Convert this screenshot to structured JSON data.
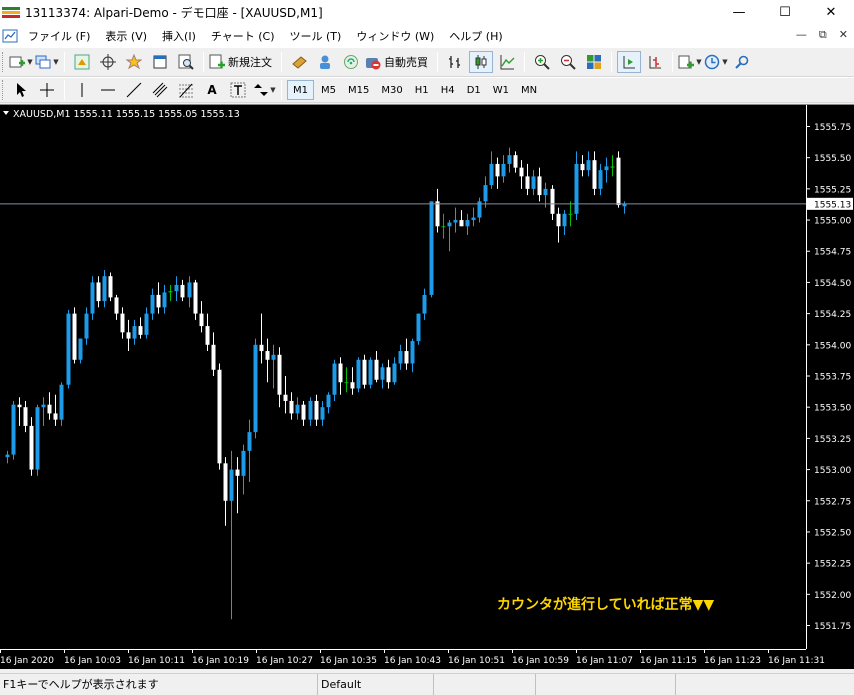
{
  "window": {
    "title": "13113374: Alpari-Demo - デモ口座 - [XAUUSD,M1]",
    "minimize": "—",
    "maximize": "☐",
    "close": "✕"
  },
  "menu": {
    "items": [
      "ファイル (F)",
      "表示 (V)",
      "挿入(I)",
      "チャート (C)",
      "ツール (T)",
      "ウィンドウ (W)",
      "ヘルプ (H)"
    ],
    "mdi": [
      "—",
      "⧉",
      "✕"
    ]
  },
  "toolbar": {
    "new_order_label": "新規注文",
    "auto_trade_label": "自動売買"
  },
  "timeframes": [
    "M1",
    "M5",
    "M15",
    "M30",
    "H1",
    "H4",
    "D1",
    "W1",
    "MN"
  ],
  "timeframe_selected": "M1",
  "chart_data": {
    "type": "candlestick",
    "symbol_info": "XAUUSD,M1  1555.11 1555.15 1555.05 1555.13",
    "current_price": "1555.13",
    "ylim": [
      1551.65,
      1555.85
    ],
    "y_ticks": [
      "1555.75",
      "1555.50",
      "1555.25",
      "1555.00",
      "1554.75",
      "1554.50",
      "1554.25",
      "1554.00",
      "1553.75",
      "1553.50",
      "1553.25",
      "1553.00",
      "1552.75",
      "1552.50",
      "1552.25",
      "1552.00",
      "1551.75"
    ],
    "x_ticks": [
      "16 Jan 2020",
      "16 Jan 10:03",
      "16 Jan 10:11",
      "16 Jan 10:19",
      "16 Jan 10:27",
      "16 Jan 10:35",
      "16 Jan 10:43",
      "16 Jan 10:51",
      "16 Jan 10:59",
      "16 Jan 11:07",
      "16 Jan 11:15",
      "16 Jan 11:23",
      "16 Jan 11:31"
    ],
    "annotation": "カウンタが進行していれば正常▼▼",
    "colors": {
      "bull": "#1e9be8",
      "bear": "#ffffff",
      "doji": "#00c000",
      "background": "#000000",
      "grid": "#000000",
      "axis_text": "#ffffff",
      "price_line": "#7f8f9f",
      "annotation": "#ffd700"
    },
    "candles": [
      {
        "o": 1553.1,
        "h": 1553.15,
        "l": 1553.05,
        "c": 1553.12
      },
      {
        "o": 1553.12,
        "h": 1553.55,
        "l": 1553.08,
        "c": 1553.52
      },
      {
        "o": 1553.52,
        "h": 1553.58,
        "l": 1553.35,
        "c": 1553.5
      },
      {
        "o": 1553.5,
        "h": 1553.55,
        "l": 1553.3,
        "c": 1553.35
      },
      {
        "o": 1553.35,
        "h": 1553.42,
        "l": 1552.95,
        "c": 1553.0
      },
      {
        "o": 1553.0,
        "h": 1553.52,
        "l": 1552.95,
        "c": 1553.5
      },
      {
        "o": 1553.5,
        "h": 1553.58,
        "l": 1553.35,
        "c": 1553.52
      },
      {
        "o": 1553.52,
        "h": 1553.62,
        "l": 1553.4,
        "c": 1553.45
      },
      {
        "o": 1553.45,
        "h": 1553.6,
        "l": 1553.35,
        "c": 1553.4
      },
      {
        "o": 1553.4,
        "h": 1553.7,
        "l": 1553.35,
        "c": 1553.68
      },
      {
        "o": 1553.68,
        "h": 1554.28,
        "l": 1553.65,
        "c": 1554.25
      },
      {
        "o": 1554.25,
        "h": 1554.3,
        "l": 1553.85,
        "c": 1553.88
      },
      {
        "o": 1553.88,
        "h": 1554.05,
        "l": 1553.85,
        "c": 1554.05
      },
      {
        "o": 1554.05,
        "h": 1554.3,
        "l": 1554.0,
        "c": 1554.25
      },
      {
        "o": 1554.25,
        "h": 1554.55,
        "l": 1554.2,
        "c": 1554.5
      },
      {
        "o": 1554.5,
        "h": 1554.55,
        "l": 1554.3,
        "c": 1554.35
      },
      {
        "o": 1554.35,
        "h": 1554.6,
        "l": 1554.3,
        "c": 1554.55
      },
      {
        "o": 1554.55,
        "h": 1554.58,
        "l": 1554.35,
        "c": 1554.38
      },
      {
        "o": 1554.38,
        "h": 1554.4,
        "l": 1554.2,
        "c": 1554.25
      },
      {
        "o": 1554.25,
        "h": 1554.3,
        "l": 1554.05,
        "c": 1554.1
      },
      {
        "o": 1554.1,
        "h": 1554.2,
        "l": 1553.95,
        "c": 1554.05
      },
      {
        "o": 1554.05,
        "h": 1554.2,
        "l": 1554.0,
        "c": 1554.15
      },
      {
        "o": 1554.15,
        "h": 1554.22,
        "l": 1554.05,
        "c": 1554.08
      },
      {
        "o": 1554.08,
        "h": 1554.3,
        "l": 1554.05,
        "c": 1554.25
      },
      {
        "o": 1554.25,
        "h": 1554.45,
        "l": 1554.2,
        "c": 1554.4
      },
      {
        "o": 1554.4,
        "h": 1554.5,
        "l": 1554.25,
        "c": 1554.3
      },
      {
        "o": 1554.3,
        "h": 1554.48,
        "l": 1554.25,
        "c": 1554.42
      },
      {
        "o": 1554.42,
        "h": 1554.48,
        "l": 1554.35,
        "c": 1554.43
      },
      {
        "o": 1554.43,
        "h": 1554.55,
        "l": 1554.35,
        "c": 1554.48
      },
      {
        "o": 1554.48,
        "h": 1554.52,
        "l": 1554.35,
        "c": 1554.38
      },
      {
        "o": 1554.38,
        "h": 1554.55,
        "l": 1554.3,
        "c": 1554.5
      },
      {
        "o": 1554.5,
        "h": 1554.52,
        "l": 1554.2,
        "c": 1554.25
      },
      {
        "o": 1554.25,
        "h": 1554.35,
        "l": 1554.1,
        "c": 1554.15
      },
      {
        "o": 1554.15,
        "h": 1554.25,
        "l": 1553.95,
        "c": 1554.0
      },
      {
        "o": 1554.0,
        "h": 1554.1,
        "l": 1553.75,
        "c": 1553.8
      },
      {
        "o": 1553.8,
        "h": 1553.85,
        "l": 1553.0,
        "c": 1553.05
      },
      {
        "o": 1553.05,
        "h": 1553.1,
        "l": 1552.55,
        "c": 1552.75
      },
      {
        "o": 1552.75,
        "h": 1553.15,
        "l": 1551.8,
        "c": 1553.0
      },
      {
        "o": 1553.0,
        "h": 1553.1,
        "l": 1552.65,
        "c": 1552.95
      },
      {
        "o": 1552.95,
        "h": 1553.2,
        "l": 1552.8,
        "c": 1553.15
      },
      {
        "o": 1553.15,
        "h": 1553.4,
        "l": 1552.9,
        "c": 1553.3
      },
      {
        "o": 1553.3,
        "h": 1554.05,
        "l": 1553.25,
        "c": 1554.0
      },
      {
        "o": 1554.0,
        "h": 1554.25,
        "l": 1553.85,
        "c": 1553.95
      },
      {
        "o": 1553.95,
        "h": 1554.05,
        "l": 1553.7,
        "c": 1553.88
      },
      {
        "o": 1553.88,
        "h": 1554.0,
        "l": 1553.65,
        "c": 1553.92
      },
      {
        "o": 1553.92,
        "h": 1553.98,
        "l": 1553.5,
        "c": 1553.6
      },
      {
        "o": 1553.6,
        "h": 1553.75,
        "l": 1553.45,
        "c": 1553.55
      },
      {
        "o": 1553.55,
        "h": 1553.62,
        "l": 1553.4,
        "c": 1553.45
      },
      {
        "o": 1553.45,
        "h": 1553.58,
        "l": 1553.4,
        "c": 1553.52
      },
      {
        "o": 1553.52,
        "h": 1553.55,
        "l": 1553.35,
        "c": 1553.4
      },
      {
        "o": 1553.4,
        "h": 1553.58,
        "l": 1553.35,
        "c": 1553.55
      },
      {
        "o": 1553.55,
        "h": 1553.6,
        "l": 1553.35,
        "c": 1553.4
      },
      {
        "o": 1553.4,
        "h": 1553.55,
        "l": 1553.35,
        "c": 1553.5
      },
      {
        "o": 1553.5,
        "h": 1553.62,
        "l": 1553.45,
        "c": 1553.6
      },
      {
        "o": 1553.6,
        "h": 1553.88,
        "l": 1553.55,
        "c": 1553.85
      },
      {
        "o": 1553.85,
        "h": 1553.9,
        "l": 1553.6,
        "c": 1553.7
      },
      {
        "o": 1553.7,
        "h": 1553.82,
        "l": 1553.62,
        "c": 1553.7
      },
      {
        "o": 1553.7,
        "h": 1553.82,
        "l": 1553.6,
        "c": 1553.65
      },
      {
        "o": 1553.65,
        "h": 1553.9,
        "l": 1553.62,
        "c": 1553.88
      },
      {
        "o": 1553.88,
        "h": 1553.92,
        "l": 1553.65,
        "c": 1553.68
      },
      {
        "o": 1553.68,
        "h": 1553.9,
        "l": 1553.65,
        "c": 1553.88
      },
      {
        "o": 1553.88,
        "h": 1553.95,
        "l": 1553.7,
        "c": 1553.72
      },
      {
        "o": 1553.72,
        "h": 1553.85,
        "l": 1553.65,
        "c": 1553.82
      },
      {
        "o": 1553.82,
        "h": 1553.88,
        "l": 1553.65,
        "c": 1553.7
      },
      {
        "o": 1553.7,
        "h": 1553.9,
        "l": 1553.68,
        "c": 1553.85
      },
      {
        "o": 1553.85,
        "h": 1554.0,
        "l": 1553.8,
        "c": 1553.95
      },
      {
        "o": 1553.95,
        "h": 1554.05,
        "l": 1553.8,
        "c": 1553.85
      },
      {
        "o": 1553.85,
        "h": 1554.05,
        "l": 1553.78,
        "c": 1554.03
      },
      {
        "o": 1554.03,
        "h": 1554.25,
        "l": 1554.0,
        "c": 1554.25
      },
      {
        "o": 1554.25,
        "h": 1554.45,
        "l": 1554.2,
        "c": 1554.4
      },
      {
        "o": 1554.4,
        "h": 1555.15,
        "l": 1554.38,
        "c": 1555.15
      },
      {
        "o": 1555.15,
        "h": 1555.25,
        "l": 1554.9,
        "c": 1554.95
      },
      {
        "o": 1554.95,
        "h": 1555.05,
        "l": 1554.85,
        "c": 1554.95
      },
      {
        "o": 1554.95,
        "h": 1555.0,
        "l": 1554.75,
        "c": 1554.98
      },
      {
        "o": 1554.98,
        "h": 1555.1,
        "l": 1554.9,
        "c": 1555.0
      },
      {
        "o": 1555.0,
        "h": 1555.08,
        "l": 1554.95,
        "c": 1554.95
      },
      {
        "o": 1554.95,
        "h": 1555.05,
        "l": 1554.88,
        "c": 1555.0
      },
      {
        "o": 1555.0,
        "h": 1555.1,
        "l": 1554.95,
        "c": 1555.02
      },
      {
        "o": 1555.02,
        "h": 1555.18,
        "l": 1554.98,
        "c": 1555.15
      },
      {
        "o": 1555.15,
        "h": 1555.35,
        "l": 1555.1,
        "c": 1555.28
      },
      {
        "o": 1555.28,
        "h": 1555.55,
        "l": 1555.25,
        "c": 1555.45
      },
      {
        "o": 1555.45,
        "h": 1555.5,
        "l": 1555.25,
        "c": 1555.35
      },
      {
        "o": 1555.35,
        "h": 1555.52,
        "l": 1555.3,
        "c": 1555.45
      },
      {
        "o": 1555.45,
        "h": 1555.58,
        "l": 1555.38,
        "c": 1555.52
      },
      {
        "o": 1555.52,
        "h": 1555.55,
        "l": 1555.38,
        "c": 1555.42
      },
      {
        "o": 1555.42,
        "h": 1555.48,
        "l": 1555.25,
        "c": 1555.35
      },
      {
        "o": 1555.35,
        "h": 1555.45,
        "l": 1555.2,
        "c": 1555.25
      },
      {
        "o": 1555.25,
        "h": 1555.4,
        "l": 1555.2,
        "c": 1555.35
      },
      {
        "o": 1555.35,
        "h": 1555.42,
        "l": 1555.15,
        "c": 1555.2
      },
      {
        "o": 1555.2,
        "h": 1555.3,
        "l": 1555.1,
        "c": 1555.25
      },
      {
        "o": 1555.25,
        "h": 1555.28,
        "l": 1555.0,
        "c": 1555.05
      },
      {
        "o": 1555.05,
        "h": 1555.1,
        "l": 1554.82,
        "c": 1554.95
      },
      {
        "o": 1554.95,
        "h": 1555.08,
        "l": 1554.88,
        "c": 1555.05
      },
      {
        "o": 1555.05,
        "h": 1555.15,
        "l": 1554.95,
        "c": 1555.05
      },
      {
        "o": 1555.05,
        "h": 1555.55,
        "l": 1555.0,
        "c": 1555.45
      },
      {
        "o": 1555.45,
        "h": 1555.52,
        "l": 1555.35,
        "c": 1555.4
      },
      {
        "o": 1555.4,
        "h": 1555.55,
        "l": 1555.35,
        "c": 1555.48
      },
      {
        "o": 1555.48,
        "h": 1555.55,
        "l": 1555.2,
        "c": 1555.25
      },
      {
        "o": 1555.25,
        "h": 1555.45,
        "l": 1555.2,
        "c": 1555.4
      },
      {
        "o": 1555.4,
        "h": 1555.5,
        "l": 1555.3,
        "c": 1555.43
      },
      {
        "o": 1555.43,
        "h": 1555.52,
        "l": 1555.35,
        "c": 1555.42
      },
      {
        "o": 1555.5,
        "h": 1555.55,
        "l": 1555.1,
        "c": 1555.12
      },
      {
        "o": 1555.11,
        "h": 1555.15,
        "l": 1555.05,
        "c": 1555.13
      }
    ]
  },
  "status": {
    "help_text": "F1キーでヘルプが表示されます",
    "profile": "Default"
  }
}
